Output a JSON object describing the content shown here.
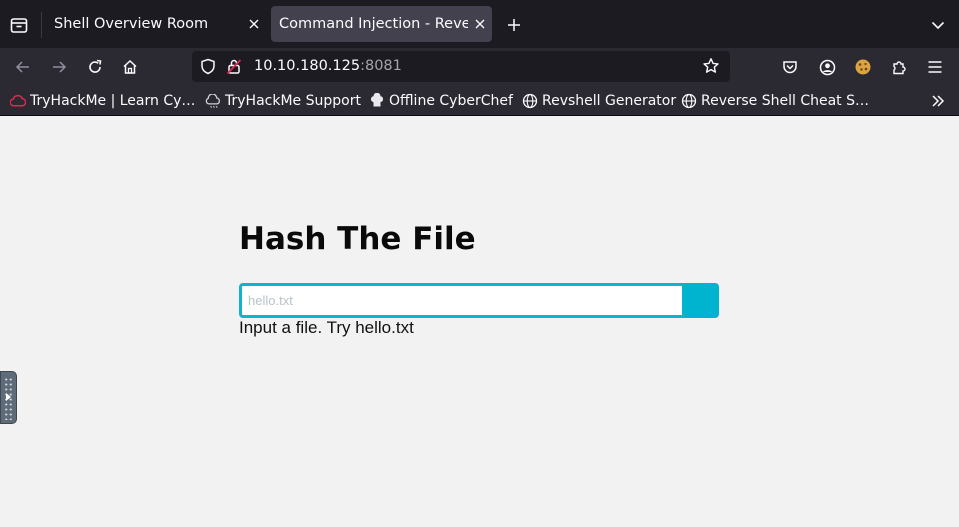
{
  "tabs": [
    {
      "title": "Shell Overview Room",
      "active": false
    },
    {
      "title": "Command Injection - Reverse",
      "active": true
    }
  ],
  "navbar": {
    "url_host": "10.10.180.125",
    "url_port": ":8081"
  },
  "bookmarks": [
    {
      "label": "TryHackMe | Learn Cy…",
      "icon": "tryhackme-icon"
    },
    {
      "label": "TryHackMe Support",
      "icon": "cloud-support-icon"
    },
    {
      "label": "Offline CyberChef",
      "icon": "chef-hat-icon"
    },
    {
      "label": "Revshell Generator",
      "icon": "globe-icon"
    },
    {
      "label": "Reverse Shell Cheat S…",
      "icon": "globe-icon"
    }
  ],
  "page": {
    "title": "Hash The File",
    "input_placeholder": "hello.txt",
    "input_value": "",
    "hint": "Input a file. Try hello.txt"
  },
  "colors": {
    "accent": "#00b4d0",
    "page_bg": "#f2f2f2",
    "chrome_dark": "#1c1b22",
    "chrome_mid": "#2b2a33"
  }
}
